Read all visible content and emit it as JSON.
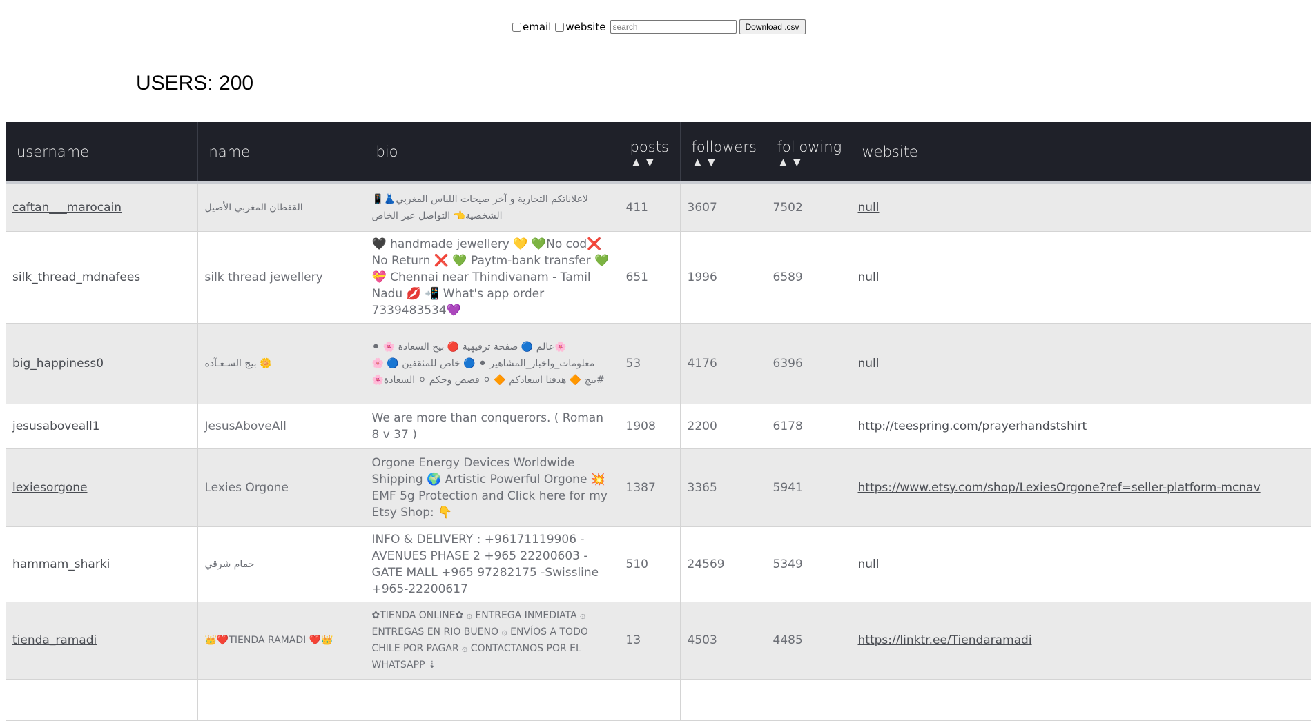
{
  "toolbar": {
    "email_label": "email",
    "website_label": "website",
    "search_placeholder": "search",
    "download_label": "Download .csv"
  },
  "users_count": "USERS: 200",
  "table": {
    "headers": {
      "username": "username",
      "name": "name",
      "bio": "bio",
      "posts": "posts",
      "followers": "followers",
      "following": "following",
      "website": "website",
      "sort_arrows": "▲▼"
    },
    "rows": [
      {
        "username": "caftan___marocain",
        "name": "القفطان المغربي الأصيل",
        "bio": "لاعلاناتكم التجارية و آخر صيحات اللباس المغربي👗📱 الشخصية👈 التواصل عبر الخاص",
        "posts": "411",
        "followers": "3607",
        "following": "7502",
        "website": "null"
      },
      {
        "username": "silk_thread_mdnafees",
        "name": "silk thread jewellery",
        "bio": "🖤 handmade jewellery 💛 💚No cod❌ No Return ❌ 💚 Paytm-bank transfer 💚 💝 Chennai near Thindivanam - Tamil Nadu 💋 📲 What's app order 7339483534💜",
        "posts": "651",
        "followers": "1996",
        "following": "6589",
        "website": "null"
      },
      {
        "username": "big_happiness0",
        "name": "بيج السـعـآدة 🌼",
        "bio": "🌸عالم 🔵 صفحة ترفيهية 🔴 بيج السعادة 🌸 ⚫ معلومات_واخبار_المشاهير ⚫ 🔵 خاص للمثقفين 🔵 🌸#بيج 🔶 هدفنا اسعادكم 🔶 ⚪ قصص وحكم ⚪ السعادة🌸",
        "posts": "53",
        "followers": "4176",
        "following": "6396",
        "website": "null"
      },
      {
        "username": "jesusaboveall1",
        "name": "JesusAboveAll",
        "bio": "We are more than conquerors. ( Roman 8 v 37 )",
        "posts": "1908",
        "followers": "2200",
        "following": "6178",
        "website": "http://teespring.com/prayerhandstshirt"
      },
      {
        "username": "lexiesorgone",
        "name": "Lexies Orgone",
        "bio": "Orgone Energy Devices Worldwide Shipping 🌍 Artistic Powerful Orgone 💥 EMF 5g Protection and Click here for my Etsy Shop: 👇",
        "posts": "1387",
        "followers": "3365",
        "following": "5941",
        "website": "https://www.etsy.com/shop/LexiesOrgone?ref=seller-platform-mcnav"
      },
      {
        "username": "hammam_sharki",
        "name": "حمام شرقي",
        "bio": "INFO & DELIVERY : +96171119906 - AVENUES PHASE 2 +965 22200603 -GATE MALL +965 97282175 -Swissline +965-22200617",
        "posts": "510",
        "followers": "24569",
        "following": "5349",
        "website": "null"
      },
      {
        "username": "tienda_ramadi",
        "name": "👑❤️TIENDA RAMADI ❤️👑",
        "bio": "✿TIENDA ONLINE✿ ۞ ENTREGA INMEDIATA ۞ ENTREGAS EN RIO BUENO ۞ ENVÍOS A TODO CHILE POR PAGAR ۞ CONTACTANOS POR EL WHATSAPP ⇣",
        "posts": "13",
        "followers": "4503",
        "following": "4485",
        "website": "https://linktr.ee/Tiendaramadi"
      },
      {
        "username": "",
        "name": "",
        "bio": "",
        "posts": "",
        "followers": "",
        "following": "",
        "website": ""
      }
    ]
  }
}
